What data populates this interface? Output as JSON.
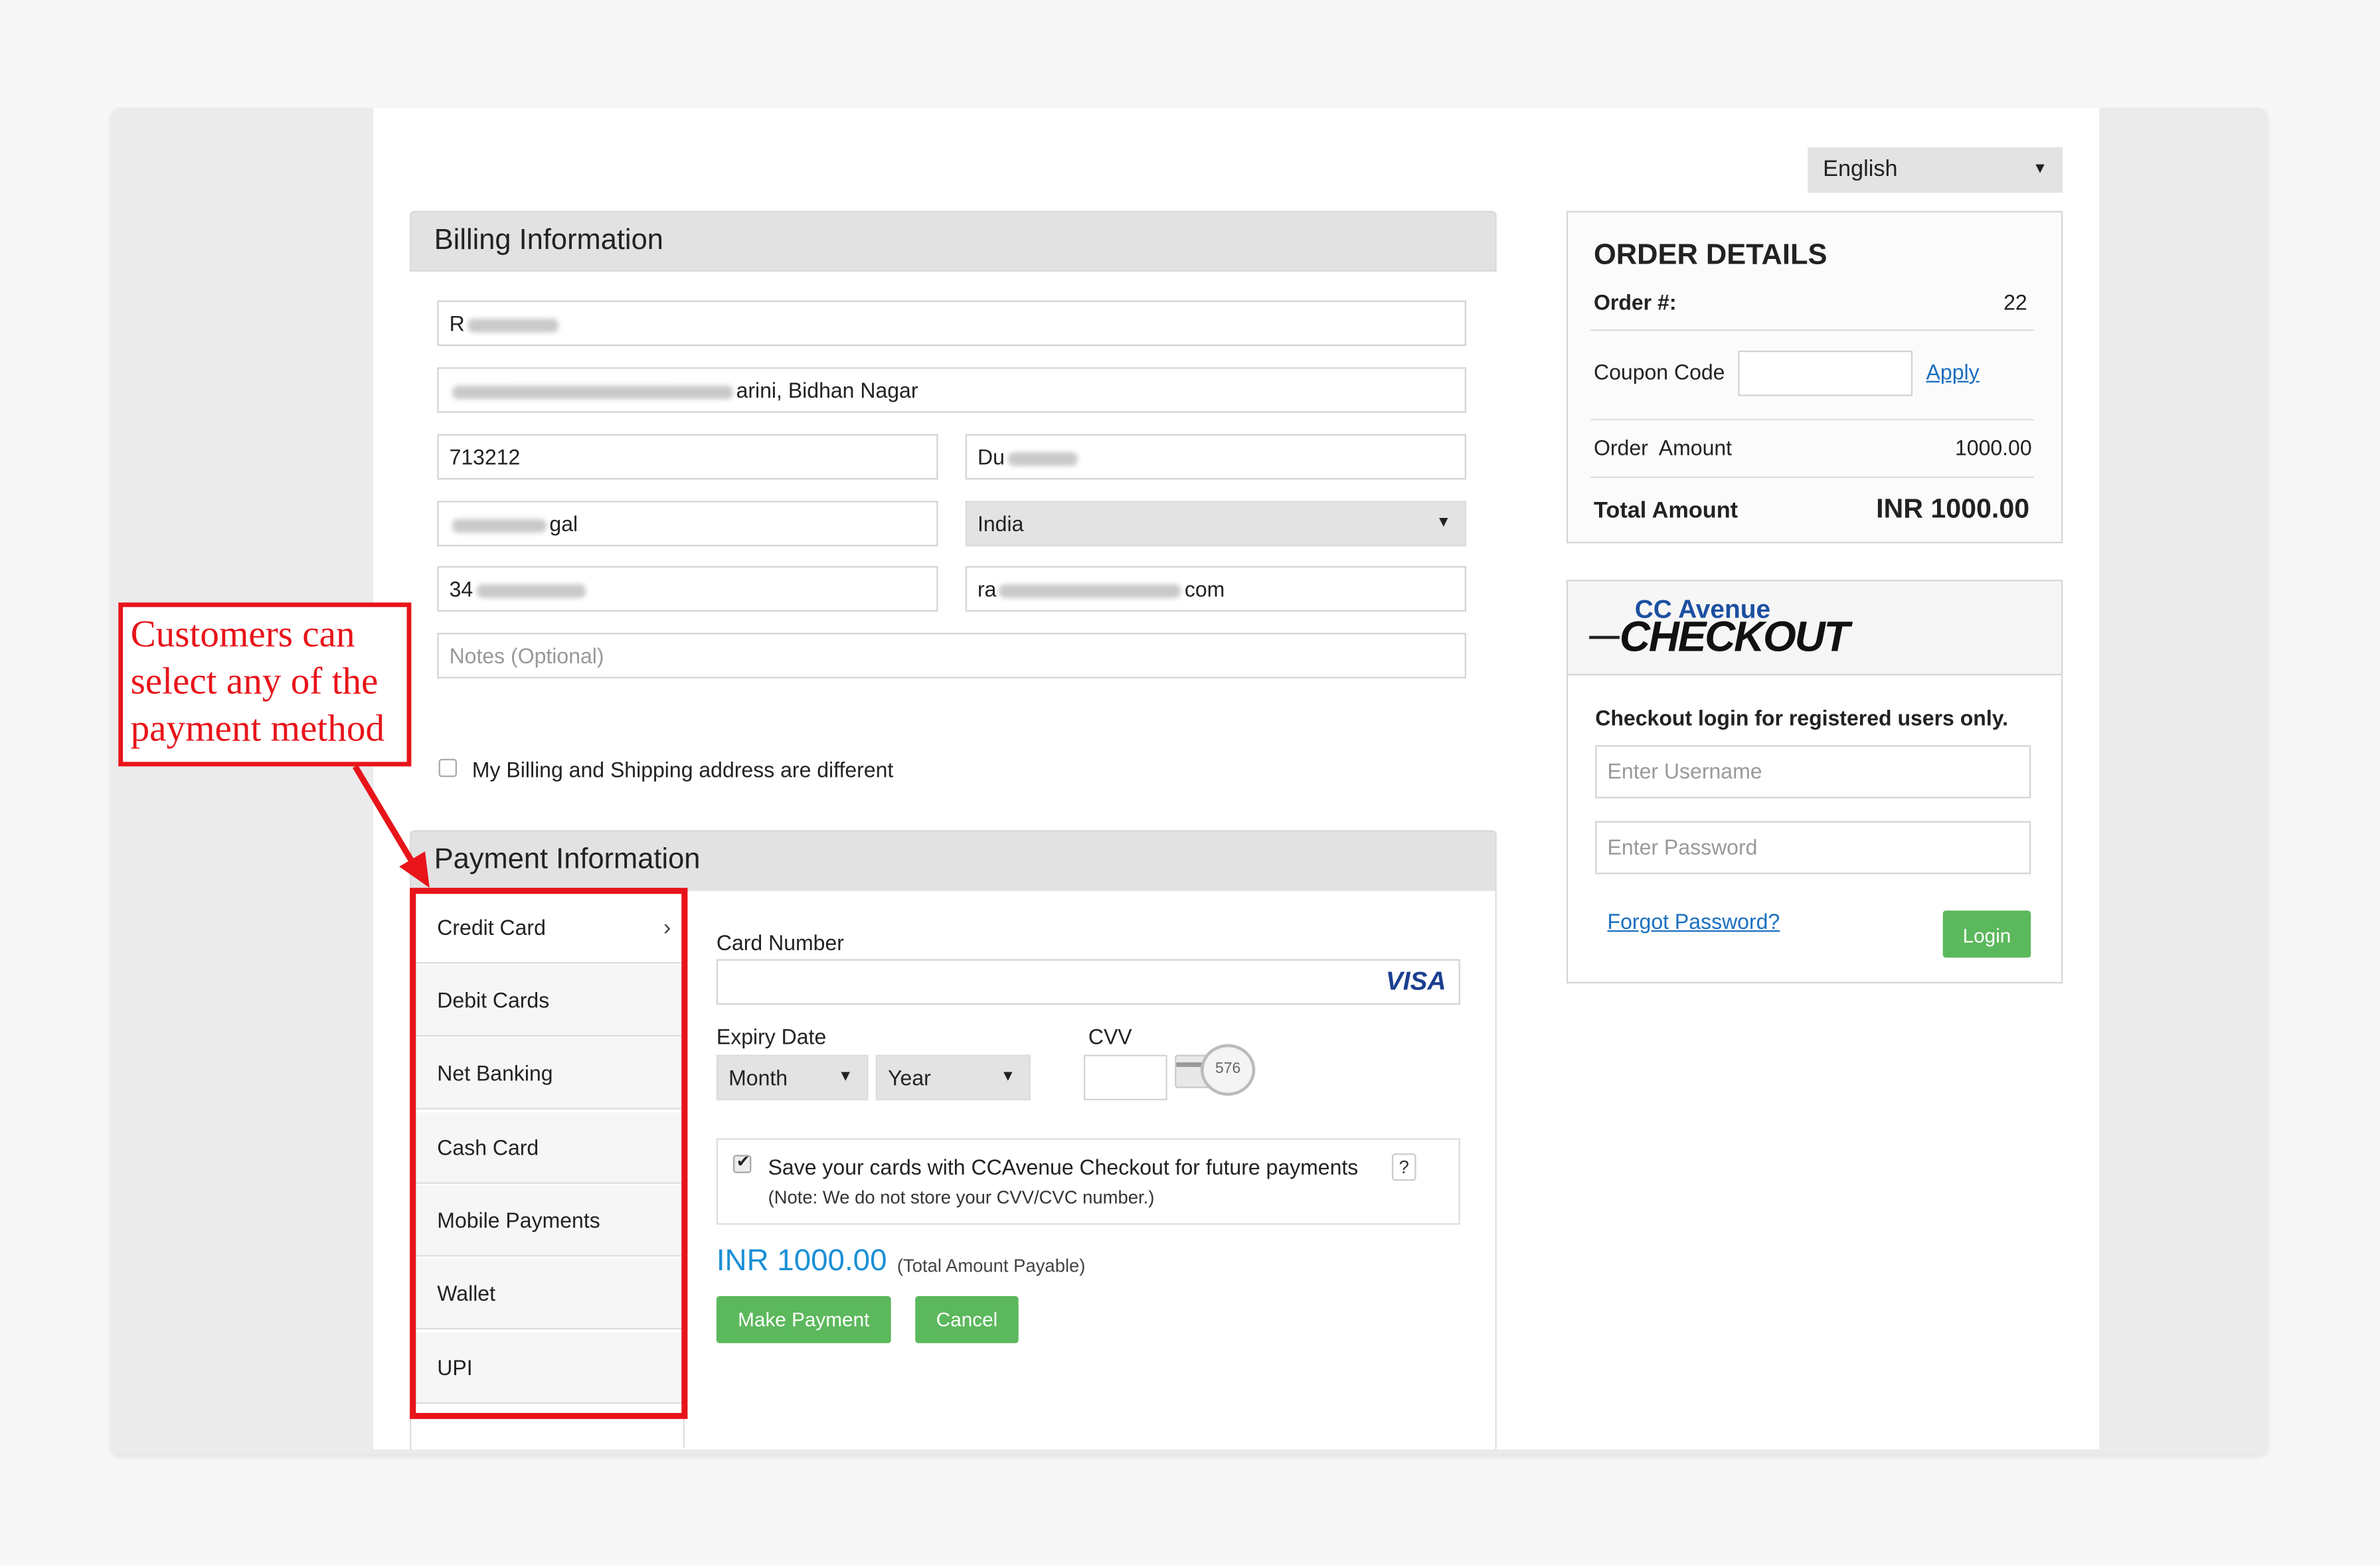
{
  "language": {
    "selected": "English"
  },
  "billing": {
    "title": "Billing Information",
    "name_prefix": "R",
    "address_suffix": "arini, Bidhan Nagar",
    "zip": "713212",
    "city_prefix": "Du",
    "state_suffix": "gal",
    "country": "India",
    "phone_prefix": "34",
    "email_prefix": "ra",
    "email_suffix": "com",
    "notes_placeholder": "Notes (Optional)",
    "different_address_label": "My Billing and Shipping address are different"
  },
  "payment": {
    "title": "Payment Information",
    "methods": [
      "Credit Card",
      "Debit Cards",
      "Net Banking",
      "Cash Card",
      "Mobile Payments",
      "Wallet",
      "UPI"
    ],
    "card_number_label": "Card Number",
    "card_brand": "VISA",
    "expiry_label": "Expiry Date",
    "month_label": "Month",
    "year_label": "Year",
    "cvv_label": "CVV",
    "cvv_hint": "576",
    "save_cards_label": "Save your cards with CCAvenue Checkout for future payments",
    "help_label": "?",
    "save_note": "(Note: We do not store your CVV/CVC number.)",
    "amount": "INR 1000.00",
    "amount_note": "(Total Amount Payable)",
    "make_payment_label": "Make Payment",
    "cancel_label": "Cancel"
  },
  "order": {
    "title": "ORDER DETAILS",
    "order_no_label": "Order #:",
    "order_no": "22",
    "coupon_label": "Coupon Code",
    "apply_label": "Apply",
    "order_amount_label": "Order  Amount",
    "order_amount": "1000.00",
    "total_label": "Total Amount",
    "total": "INR 1000.00"
  },
  "login": {
    "logo_top": "CC Avenue",
    "logo_bottom": "CHECKOUT",
    "heading": "Checkout login for registered users only.",
    "username_placeholder": "Enter Username",
    "password_placeholder": "Enter Password",
    "forgot_label": "Forgot Password?",
    "login_label": "Login"
  },
  "annotation": {
    "line1": "Customers can",
    "line2": "select any of the",
    "line3": "payment method"
  },
  "colors": {
    "accent_green": "#5cb85c",
    "link_blue": "#1a6fc0",
    "annotation_red": "#e8141a",
    "amount_blue": "#1a8fd6"
  }
}
